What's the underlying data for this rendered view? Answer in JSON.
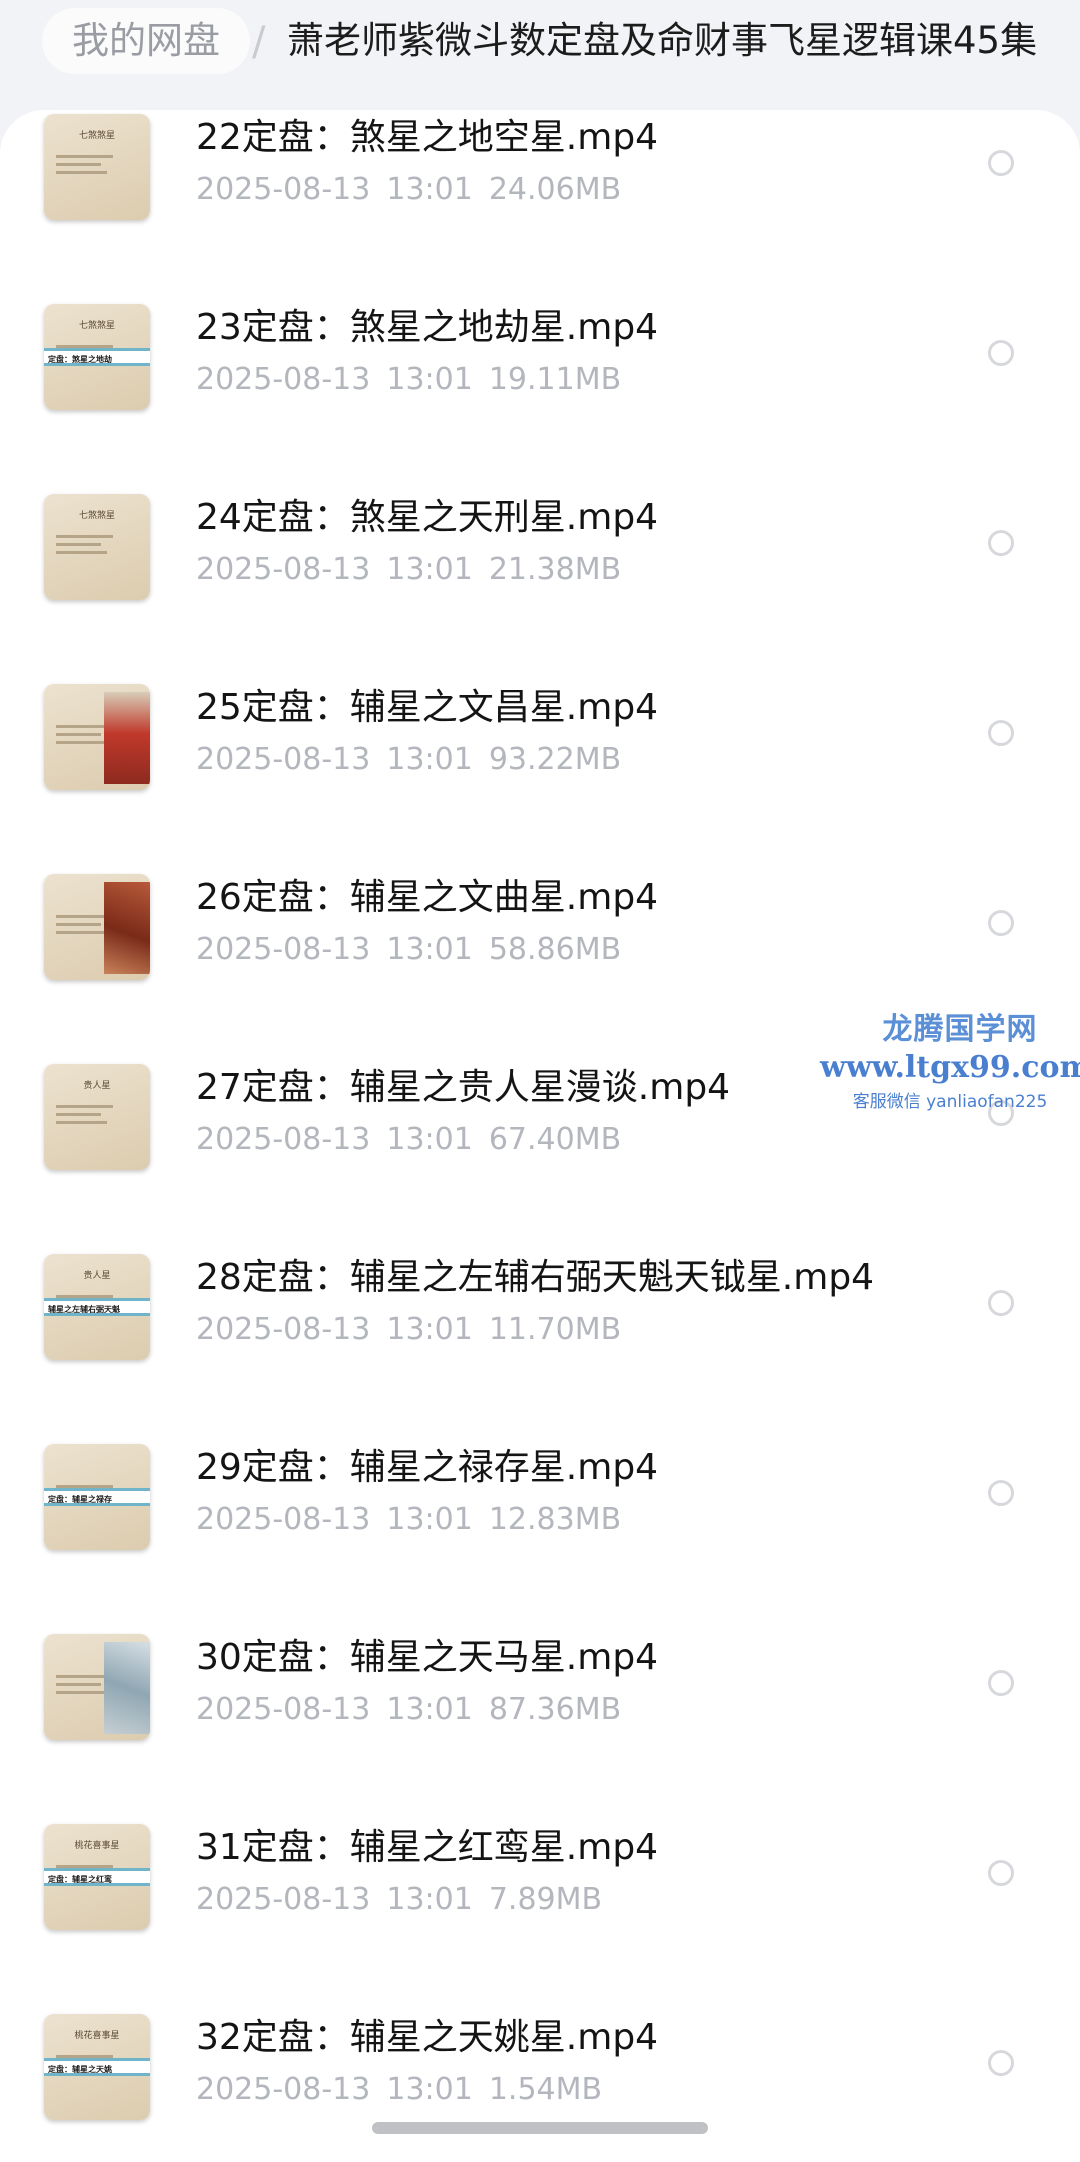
{
  "breadcrumb": {
    "root": "我的网盘",
    "separator": "/",
    "current": "萧老师紫微斗数定盘及命财事飞星逻辑课45集"
  },
  "files": [
    {
      "name": "22定盘：煞星之地空星.mp4",
      "date": "2025-08-13",
      "time": "13:01",
      "size": "24.06MB",
      "thumb_head": "七煞煞星",
      "thumb_band": "",
      "thumb_style": "plain"
    },
    {
      "name": "23定盘：煞星之地劫星.mp4",
      "date": "2025-08-13",
      "time": "13:01",
      "size": "19.11MB",
      "thumb_head": "七煞煞星",
      "thumb_band": "定盘：煞星之地劫",
      "thumb_style": "banded"
    },
    {
      "name": "24定盘：煞星之天刑星.mp4",
      "date": "2025-08-13",
      "time": "13:01",
      "size": "21.38MB",
      "thumb_head": "七煞煞星",
      "thumb_band": "",
      "thumb_style": "plain"
    },
    {
      "name": "25定盘：辅星之文昌星.mp4",
      "date": "2025-08-13",
      "time": "13:01",
      "size": "93.22MB",
      "thumb_head": "",
      "thumb_band": "",
      "thumb_style": "picture pic-red"
    },
    {
      "name": "26定盘：辅星之文曲星.mp4",
      "date": "2025-08-13",
      "time": "13:01",
      "size": "58.86MB",
      "thumb_head": "",
      "thumb_band": "",
      "thumb_style": "picture pic-art"
    },
    {
      "name": "27定盘：辅星之贵人星漫谈.mp4",
      "date": "2025-08-13",
      "time": "13:01",
      "size": "67.40MB",
      "thumb_head": "贵人星",
      "thumb_band": "",
      "thumb_style": "plain"
    },
    {
      "name": "28定盘：辅星之左辅右弼天魁天钺星.mp4",
      "date": "2025-08-13",
      "time": "13:01",
      "size": "11.70MB",
      "thumb_head": "贵人星",
      "thumb_band": "辅星之左辅右弼天魁",
      "thumb_style": "banded"
    },
    {
      "name": "29定盘：辅星之禄存星.mp4",
      "date": "2025-08-13",
      "time": "13:01",
      "size": "12.83MB",
      "thumb_head": "",
      "thumb_band": "定盘：辅星之禄存",
      "thumb_style": "banded"
    },
    {
      "name": "30定盘：辅星之天马星.mp4",
      "date": "2025-08-13",
      "time": "13:01",
      "size": "87.36MB",
      "thumb_head": "",
      "thumb_band": "",
      "thumb_style": "picture pic-blue"
    },
    {
      "name": "31定盘：辅星之红鸾星.mp4",
      "date": "2025-08-13",
      "time": "13:01",
      "size": "7.89MB",
      "thumb_head": "桃花喜事星",
      "thumb_band": "定盘：辅星之红鸾",
      "thumb_style": "banded"
    },
    {
      "name": "32定盘：辅星之天姚星.mp4",
      "date": "2025-08-13",
      "time": "13:01",
      "size": "1.54MB",
      "thumb_head": "桃花喜事星",
      "thumb_band": "定盘：辅星之天姚",
      "thumb_style": "banded"
    }
  ],
  "watermark": {
    "name": "龙腾国学网",
    "url": "www.ltgx99.com",
    "contact": "客服微信 yanliaofan225"
  }
}
